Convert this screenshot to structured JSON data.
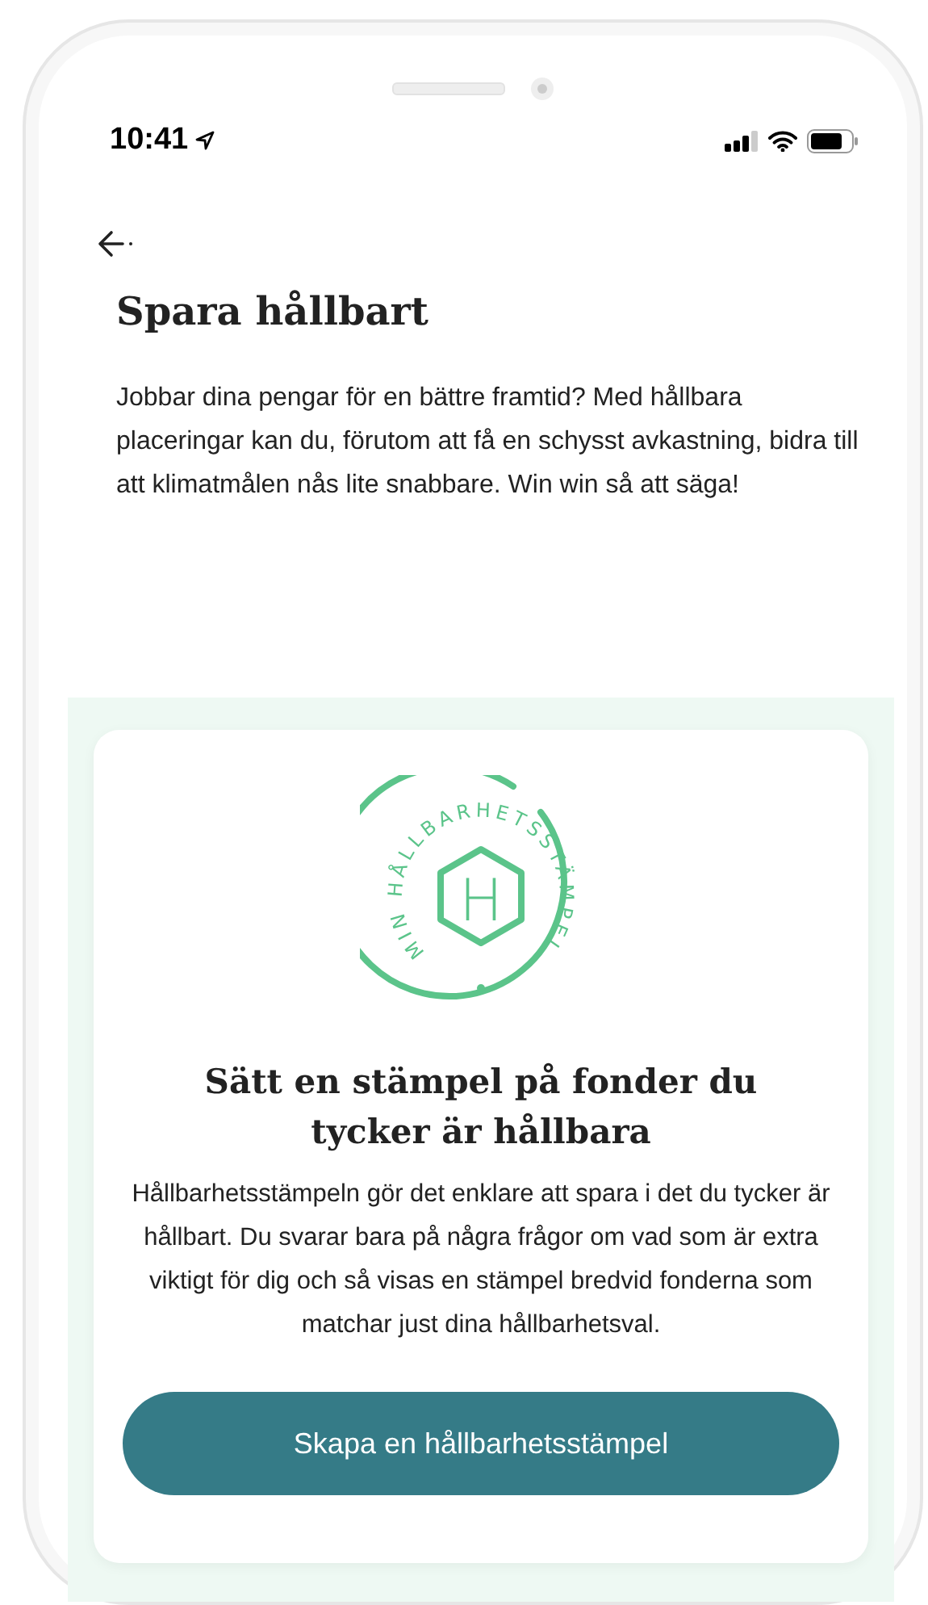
{
  "status_bar": {
    "time": "10:41"
  },
  "header": {
    "title": "Spara hållbart",
    "intro": "Jobbar dina pengar för en bättre framtid? Med hållbara placeringar kan du, förutom att få en schysst avkastning, bidra till att klimatmålen nås lite snabbare. Win win så att säga!"
  },
  "card": {
    "logo": {
      "ring_text": "MIN HÅLLBARHETSSTÄMPEL",
      "letter": "H"
    },
    "heading": "Sätt en stämpel på fonder du tycker är hållbara",
    "body": "Hållbarhetsstämpeln gör det enklare att spara i det du tycker är hållbart. Du svarar bara på några frågor om vad som är extra viktigt för dig och så visas en stämpel bredvid fonderna som matchar just dina hållbarhetsval.",
    "button": "Skapa en hållbarhetsstämpel"
  }
}
